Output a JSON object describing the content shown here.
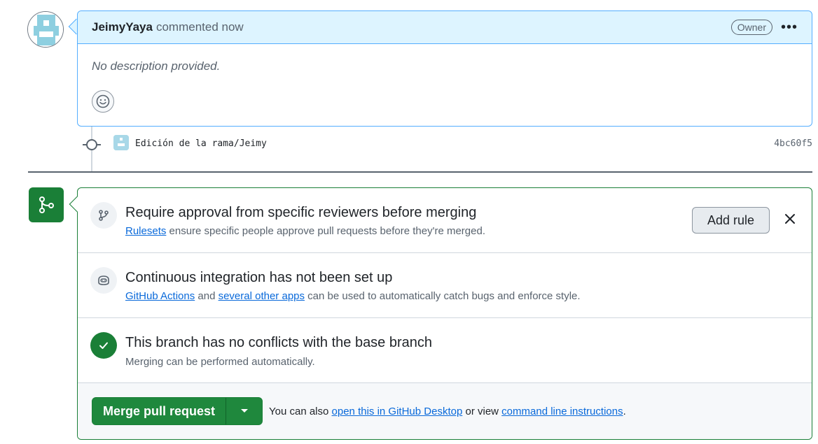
{
  "comment": {
    "author": "JeimyYaya",
    "action": "commented now",
    "badge": "Owner",
    "more_label": "•••",
    "body": "No description provided."
  },
  "commit": {
    "message": "Edición de la rama/Jeimy",
    "sha": "4bc60f5"
  },
  "merge": {
    "rule": {
      "title": "Require approval from specific reviewers before merging",
      "link_text": "Rulesets",
      "sub_text": " ensure specific people approve pull requests before they're merged.",
      "add_rule_label": "Add rule"
    },
    "ci": {
      "title": "Continuous integration has not been set up",
      "link1": "GitHub Actions",
      "mid_text": " and ",
      "link2": "several other apps",
      "tail_text": " can be used to automatically catch bugs and enforce style."
    },
    "conflicts": {
      "title": "This branch has no conflicts with the base branch",
      "sub": "Merging can be performed automatically."
    },
    "footer": {
      "merge_button": "Merge pull request",
      "pre_text": "You can also ",
      "link1": "open this in GitHub Desktop",
      "mid_text": " or view ",
      "link2": "command line instructions",
      "post_text": "."
    }
  },
  "colors": {
    "accent_blue": "#0969da",
    "success_green": "#1a7f37",
    "merge_button_green": "#1f883d",
    "comment_header_bg": "#ddf4ff"
  }
}
